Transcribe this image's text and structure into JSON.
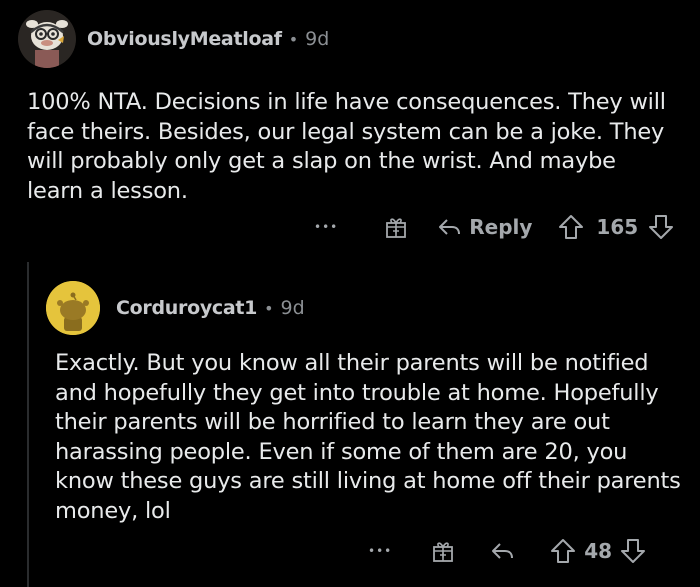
{
  "comments": [
    {
      "author": "ObviouslyMeatloaf",
      "separator": "•",
      "time": "9d",
      "body": "100% NTA. Decisions in life have consequences. They will face theirs. Besides, our legal system can be a joke. They will probably only get a slap on the wrist. And maybe learn a lesson.",
      "more": "•••",
      "reply_label": "Reply",
      "score": "165"
    },
    {
      "author": "Corduroycat1",
      "separator": "•",
      "time": "9d",
      "body": "Exactly. But you know all their parents will be notified and hopefully they get into trouble at home. Hopefully their parents will be horrified to learn they are out harassing people. Even if some of them are 20, you know these guys are still living at home off their parents money, lol",
      "more": "•••",
      "score": "48"
    }
  ],
  "colors": {
    "background": "#000000",
    "text": "#e8eaeb",
    "meta": "#8b8f93",
    "avatar_yellow": "#e5c43c"
  },
  "icons": [
    "more-icon",
    "award-icon",
    "reply-icon",
    "upvote-icon",
    "downvote-icon"
  ]
}
